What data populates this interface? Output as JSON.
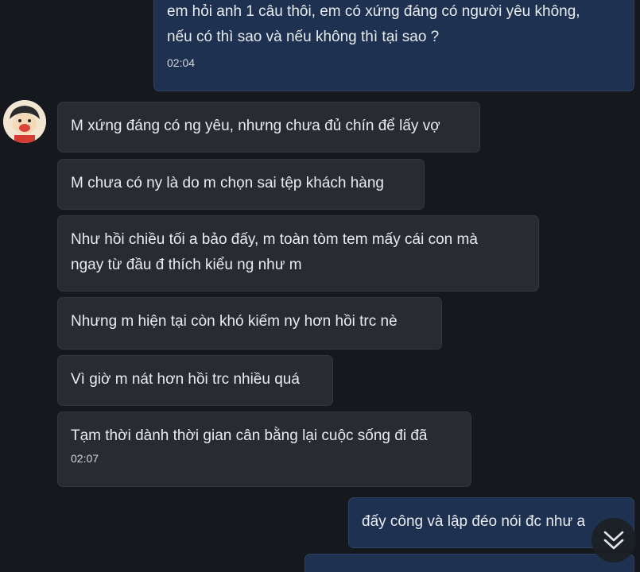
{
  "messages": {
    "m1": {
      "text": "em hỏi anh 1 câu thôi, em có xứng đáng có người yêu không,\nnếu có thì sao và nếu không thì tại sao ?",
      "time": "02:04"
    },
    "m2": {
      "text": "M xứng đáng có ng yêu, nhưng chưa đủ chín để lấy vợ"
    },
    "m3": {
      "text": "M chưa có ny là do m chọn sai tệp khách hàng"
    },
    "m4": {
      "text": "Như hồi chiều tối a bảo đấy, m toàn tòm tem mấy cái con mà\nngay từ đầu đ thích kiểu ng như m"
    },
    "m5": {
      "text": "Nhưng m hiện tại còn khó kiếm ny hơn hồi trc nè"
    },
    "m6": {
      "text": "Vì giờ m nát hơn hồi trc nhiều quá"
    },
    "m7": {
      "text": "Tạm thời dành thời gian cân bằng lại cuộc sống đi đã",
      "time": "02:07"
    },
    "m8": {
      "text": "đấy công và lập đéo nói đc như a"
    }
  },
  "icons": {
    "avatar": "cartoon-avatar",
    "scroll": "double-chevron-down-icon"
  },
  "colors": {
    "background": "#15181d",
    "outgoing_bubble": "#1f3150",
    "incoming_bubble": "#282b31"
  }
}
